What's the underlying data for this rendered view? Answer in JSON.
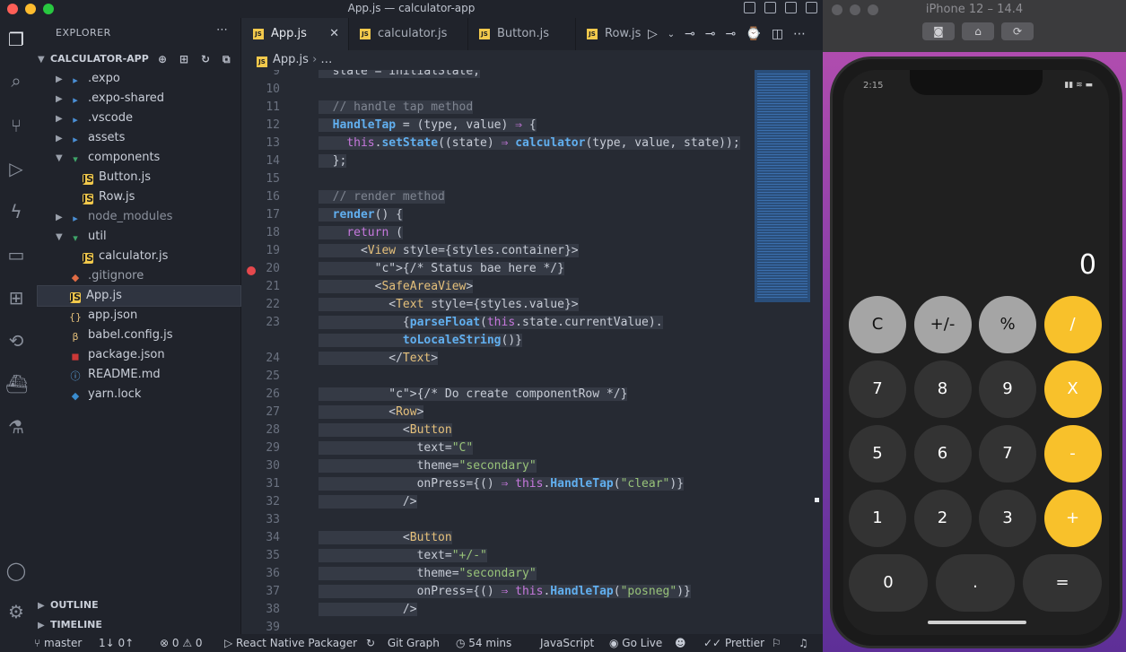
{
  "window": {
    "title": "App.js — calculator-app"
  },
  "sidebar": {
    "header": "EXPLORER",
    "project": "CALCULATOR-APP",
    "items": [
      {
        "label": ".expo",
        "type": "folder"
      },
      {
        "label": ".expo-shared",
        "type": "folder"
      },
      {
        "label": ".vscode",
        "type": "folder"
      },
      {
        "label": "assets",
        "type": "folder"
      },
      {
        "label": "components",
        "type": "folder-open"
      },
      {
        "label": "Button.js",
        "type": "js"
      },
      {
        "label": "Row.js",
        "type": "js"
      },
      {
        "label": "node_modules",
        "type": "folder"
      },
      {
        "label": "util",
        "type": "folder-open"
      },
      {
        "label": "calculator.js",
        "type": "js"
      },
      {
        "label": ".gitignore",
        "type": "git"
      },
      {
        "label": "App.js",
        "type": "js"
      },
      {
        "label": "app.json",
        "type": "json"
      },
      {
        "label": "babel.config.js",
        "type": "babel"
      },
      {
        "label": "package.json",
        "type": "npm"
      },
      {
        "label": "README.md",
        "type": "info"
      },
      {
        "label": "yarn.lock",
        "type": "yarn"
      }
    ],
    "outline": "OUTLINE",
    "timeline": "TIMELINE"
  },
  "tabs": [
    {
      "label": "App.js",
      "active": true
    },
    {
      "label": "calculator.js",
      "active": false
    },
    {
      "label": "Button.js",
      "active": false
    },
    {
      "label": "Row.js",
      "active": false
    }
  ],
  "breadcrumb": {
    "file": "App.js",
    "rest": "…"
  },
  "code": {
    "line_numbers": [
      "9",
      "10",
      "11",
      "12",
      "13",
      "14",
      "15",
      "16",
      "17",
      "18",
      "19",
      "20",
      "21",
      "22",
      "23",
      "",
      "24",
      "25",
      "26",
      "27",
      "28",
      "29",
      "30",
      "31",
      "32",
      "33",
      "34",
      "35",
      "36",
      "37",
      "38",
      "39"
    ],
    "lines": [
      "  state = initialState;",
      "",
      "  // handle tap method",
      "  HandleTap = (type, value) ⇒ {",
      "    this.setState((state) ⇒ calculator(type, value, state));",
      "  };",
      "",
      "  // render method",
      "  render() {",
      "    return (",
      "      <View style={styles.container}>",
      "        {/* Status bae here */}",
      "        <SafeAreaView>",
      "          <Text style={styles.value}>",
      "            {parseFloat(this.state.currentValue).",
      "            toLocaleString()}",
      "          </Text>",
      "",
      "          {/* Do create componentRow */}",
      "          <Row>",
      "            <Button",
      "              text=\"C\"",
      "              theme=\"secondary\"",
      "              onPress={() ⇒ this.HandleTap(\"clear\")}",
      "            />",
      "",
      "            <Button",
      "              text=\"+/-\"",
      "              theme=\"secondary\"",
      "              onPress={() ⇒ this.HandleTap(\"posneg\")}",
      "            />",
      ""
    ]
  },
  "statusbar": {
    "branch": "master",
    "sync": "1↓ 0↑",
    "problems": "⊗ 0 ⚠ 0",
    "packager": "React Native Packager",
    "gitgraph": "Git Graph",
    "time": "54 mins",
    "language": "JavaScript",
    "golive": "Go Live",
    "prettier": "Prettier"
  },
  "simulator": {
    "title": "iPhone 12 – 14.4",
    "time": "2:15",
    "display": "0",
    "keys": [
      [
        "C",
        "+/-",
        "%",
        "/"
      ],
      [
        "7",
        "8",
        "9",
        "X"
      ],
      [
        "5",
        "6",
        "7",
        "-"
      ],
      [
        "1",
        "2",
        "3",
        "+"
      ],
      [
        "0",
        ".",
        "="
      ]
    ],
    "colors": {
      "accent": "#f8c12b",
      "secondary": "#a5a5a5",
      "key": "#333333"
    }
  }
}
